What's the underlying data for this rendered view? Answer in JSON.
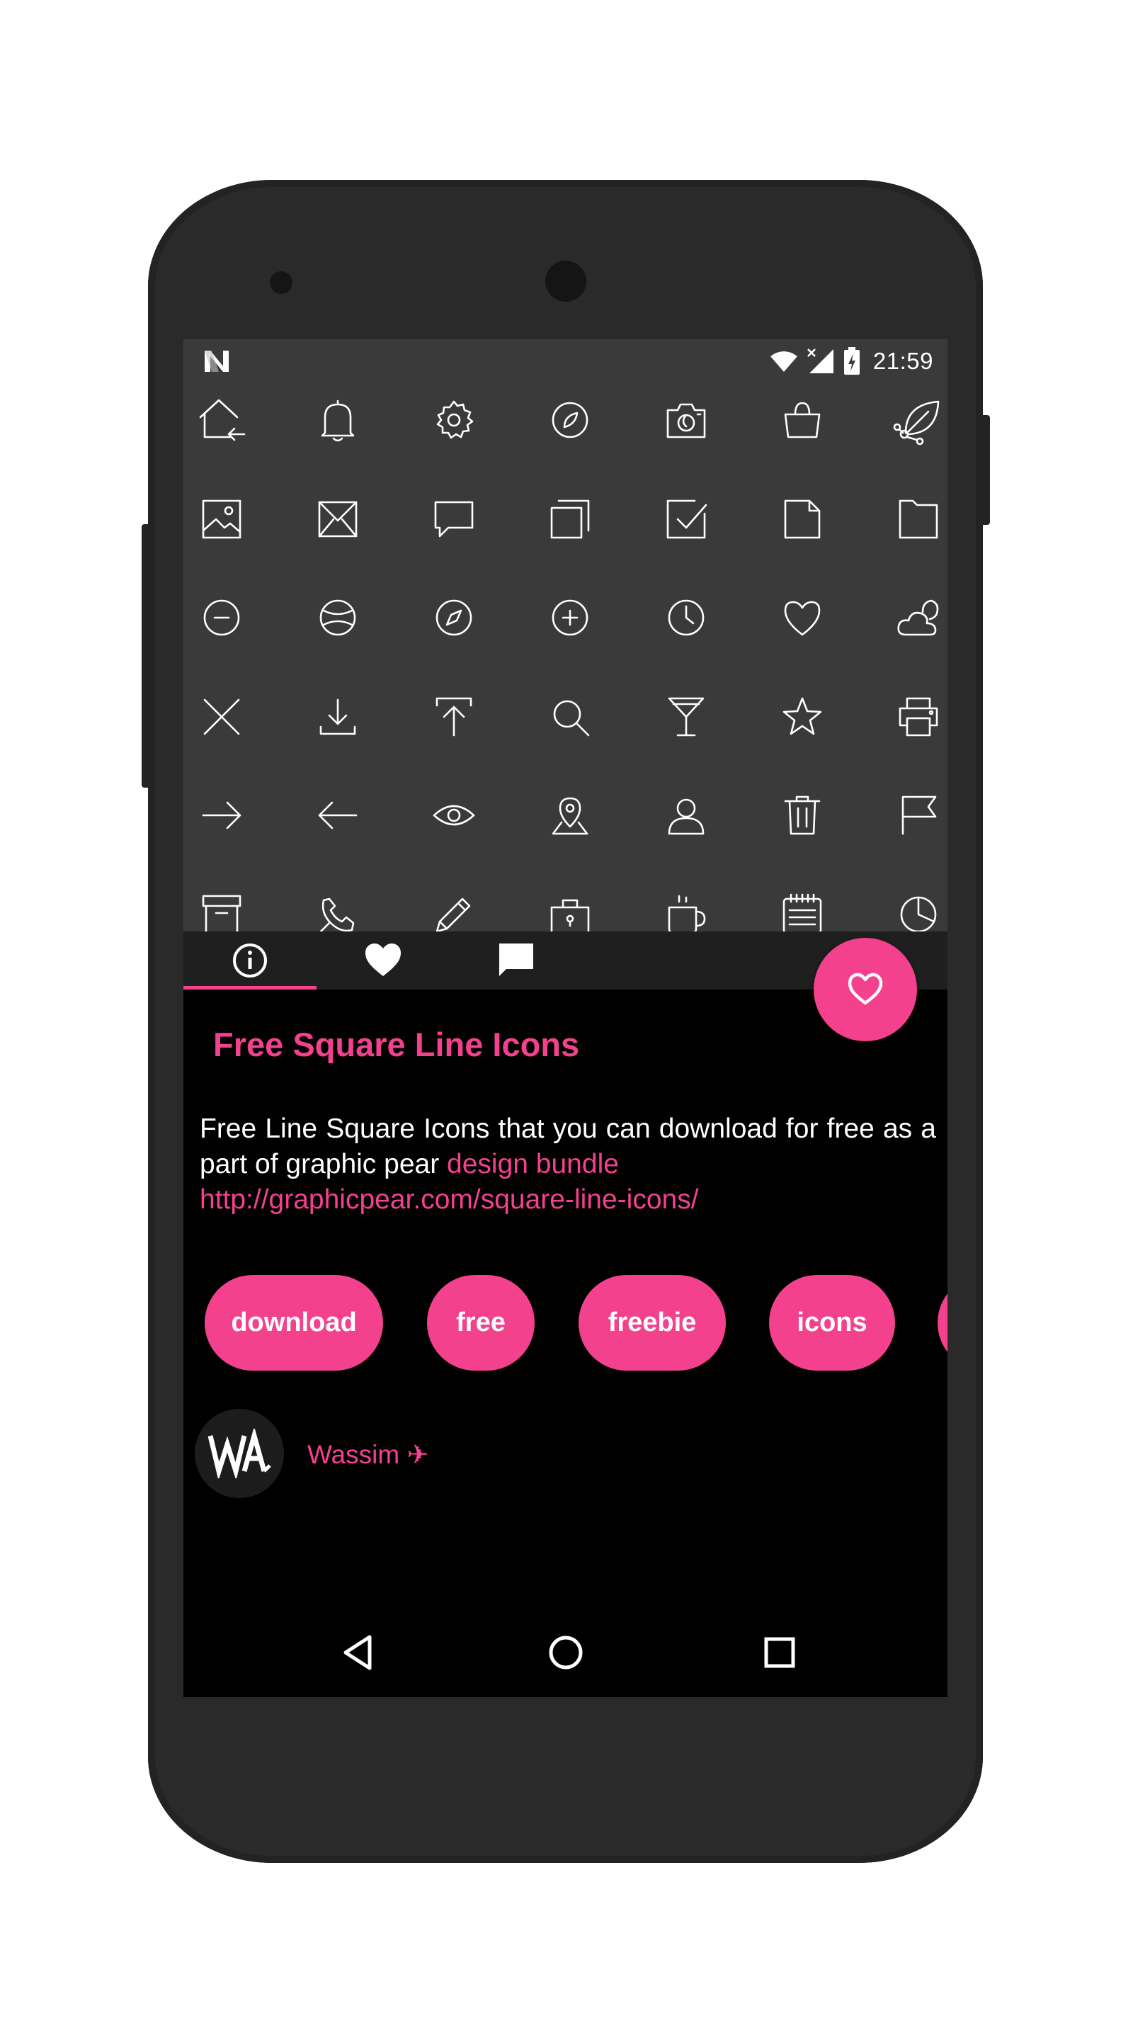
{
  "status_bar": {
    "time": "21:59",
    "icons": [
      "notification-n-icon",
      "wifi-icon",
      "signal-icon",
      "battery-charging-icon"
    ]
  },
  "icon_grid": {
    "rows": [
      [
        "home-return-icon",
        "bell-icon",
        "gear-icon",
        "compass-circle-icon",
        "camera-icon",
        "shopping-bag-icon",
        "leaf-share-icon"
      ],
      [
        "image-icon",
        "envelope-icon",
        "chat-bubble-icon",
        "copy-icon",
        "checkbox-icon",
        "document-icon",
        "folder-icon"
      ],
      [
        "minus-circle-icon",
        "ball-icon",
        "compass-icon",
        "plus-circle-icon",
        "clock-icon",
        "heart-icon",
        "weather-icon"
      ],
      [
        "close-icon",
        "download-icon",
        "upload-icon",
        "search-icon",
        "cocktail-icon",
        "star-icon",
        "printer-icon"
      ],
      [
        "arrow-right-icon",
        "arrow-left-icon",
        "eye-icon",
        "map-pin-icon",
        "user-icon",
        "trash-icon",
        "flag-icon"
      ],
      [
        "archive-icon",
        "phone-icon",
        "pencil-icon",
        "lock-bag-icon",
        "coffee-mug-icon",
        "calendar-note-icon",
        "pie-chart-icon"
      ]
    ]
  },
  "tabs": [
    {
      "icon": "info-icon",
      "active": true
    },
    {
      "icon": "heart-filled-icon",
      "active": false
    },
    {
      "icon": "comment-icon",
      "active": false
    }
  ],
  "fab": {
    "icon": "heart-outline-icon"
  },
  "title": "Free Square Line Icons",
  "description": {
    "text": "Free Line Square Icons that you can download for free as a part of graphic pear ",
    "link_text": "design bundle",
    "url": "http://graphicpear.com/square-line-icons/"
  },
  "tags": [
    "download",
    "free",
    "freebie",
    "icons",
    ""
  ],
  "author": {
    "name": "Wassim ✈",
    "avatar_text": "WA"
  },
  "nav": [
    {
      "icon": "back-triangle-icon"
    },
    {
      "icon": "home-circle-icon"
    },
    {
      "icon": "recents-square-icon"
    }
  ],
  "colors": {
    "accent": "#f4418e",
    "screen_bg": "#000000",
    "grid_bg": "#3a3a3a",
    "tab_bg": "#1f1f1f",
    "phone_body": "#2a2a2a"
  }
}
